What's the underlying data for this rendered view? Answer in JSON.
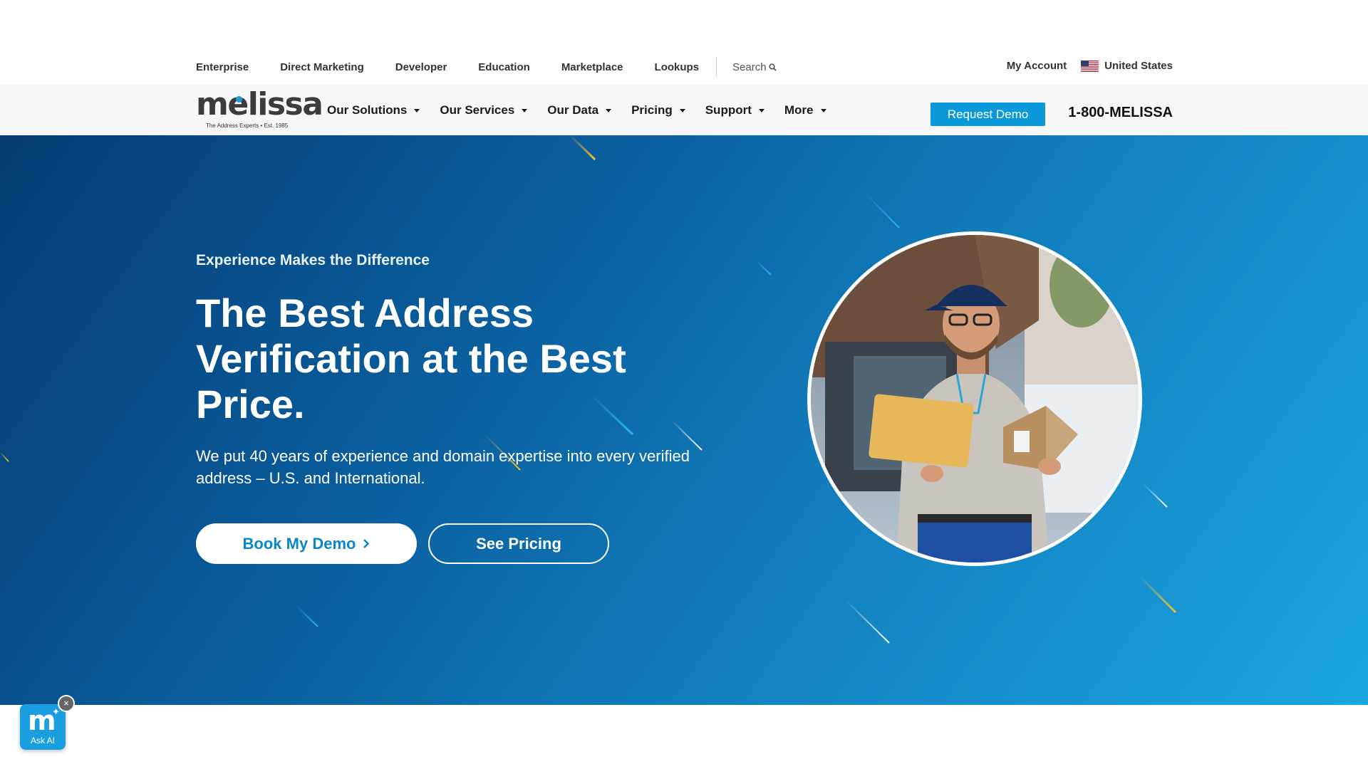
{
  "utility_nav": {
    "links": [
      "Enterprise",
      "Direct Marketing",
      "Developer",
      "Education",
      "Marketplace",
      "Lookups"
    ],
    "search_label": "Search",
    "my_account": "My Account",
    "country": "United States"
  },
  "main_nav": {
    "logo_text": "melissa",
    "logo_tagline": "The Address Experts • Est. 1985",
    "menu": [
      "Our Solutions",
      "Our Services",
      "Our Data",
      "Pricing",
      "Support",
      "More"
    ],
    "request_demo": "Request Demo",
    "phone": "1-800-MELISSA"
  },
  "hero": {
    "eyebrow": "Experience Makes the Difference",
    "headline": "The Best Address Verification at the Best Price.",
    "subtext": "We put 40 years of experience and domain expertise into every verified address – U.S. and International.",
    "primary_button": "Book My Demo",
    "secondary_button": "See Pricing"
  },
  "ask_ai": {
    "label": "Ask AI",
    "close": "×"
  },
  "colors": {
    "brand_blue": "#0b99d9",
    "hero_dark": "#053b72",
    "hero_light": "#1ba6e0",
    "button_text_blue": "#0b86c9"
  }
}
